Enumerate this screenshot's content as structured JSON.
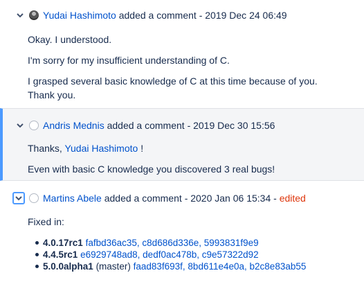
{
  "comments": [
    {
      "author": "Yudai Hashimoto",
      "action": "added a comment",
      "timestamp": "- 2019 Dec 24 06:49",
      "paragraphs": [
        "Okay. I understood.",
        "I'm sorry for my insufficient understanding of C.",
        "I grasped several basic knowledge of C at this time because of you.",
        "Thank you."
      ]
    },
    {
      "author": "Andris Mednis",
      "action": "added a comment",
      "timestamp": "- 2019 Dec 30 15:56",
      "thanks_prefix": "Thanks,",
      "mention": "Yudai Hashimoto",
      "thanks_suffix": "!",
      "paragraph2": "Even with basic C knowledge you discovered 3 real bugs!"
    },
    {
      "author": "Martins Abele",
      "action": "added a comment",
      "timestamp": "- 2020 Jan 06 15:34 -",
      "edited": "edited",
      "fixed_in_label": "Fixed in:",
      "fixes": [
        {
          "version": "4.0.17rc1",
          "note": "",
          "hashes": [
            "fafbd36ac35,",
            "c8d686d336e,",
            "5993831f9e9"
          ]
        },
        {
          "version": "4.4.5rc1",
          "note": "",
          "hashes": [
            "e6929748ad8,",
            "dedf0ac478b,",
            "c9e57322d92"
          ]
        },
        {
          "version": "5.0.0alpha1",
          "note": "(master)",
          "hashes": [
            "faad83f693f,",
            "8bd611e4e0a,",
            "b2c8e83ab55"
          ]
        }
      ]
    }
  ],
  "colors": {
    "link": "#0052cc",
    "text": "#172b4d",
    "edited": "#de350b",
    "highlight_border": "#4c9aff",
    "highlight_bg": "#f4f5f7"
  },
  "icons": {
    "chevron": "chevron-down-icon",
    "avatar_photo": "user-avatar",
    "avatar_default": "default-avatar-icon"
  }
}
